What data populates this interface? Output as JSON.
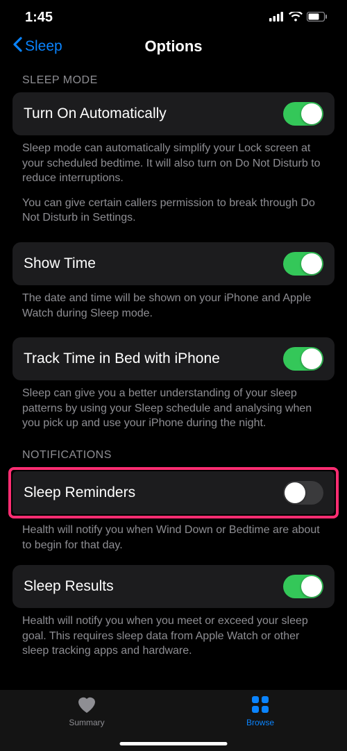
{
  "status": {
    "time": "1:45"
  },
  "nav": {
    "back": "Sleep",
    "title": "Options"
  },
  "sections": {
    "sleepMode": {
      "header": "SLEEP MODE",
      "items": {
        "auto": {
          "label": "Turn On Automatically",
          "on": true,
          "footer1": "Sleep mode can automatically simplify your Lock screen at your scheduled bedtime. It will also turn on Do Not Disturb to reduce interruptions.",
          "footer2": "You can give certain callers permission to break through Do Not Disturb in Settings."
        },
        "showTime": {
          "label": "Show Time",
          "on": true,
          "footer": "The date and time will be shown on your iPhone and Apple Watch during Sleep mode."
        },
        "track": {
          "label": "Track Time in Bed with iPhone",
          "on": true,
          "footer": "Sleep can give you a better understanding of your sleep patterns by using your Sleep schedule and analysing when you pick up and use your iPhone during the night."
        }
      }
    },
    "notifications": {
      "header": "NOTIFICATIONS",
      "items": {
        "reminders": {
          "label": "Sleep Reminders",
          "on": false,
          "footer": "Health will notify you when Wind Down or Bedtime are about to begin for that day."
        },
        "results": {
          "label": "Sleep Results",
          "on": true,
          "footer": "Health will notify you when you meet or exceed your sleep goal. This requires sleep data from Apple Watch or other sleep tracking apps and hardware."
        }
      }
    }
  },
  "tabs": {
    "summary": "Summary",
    "browse": "Browse"
  }
}
